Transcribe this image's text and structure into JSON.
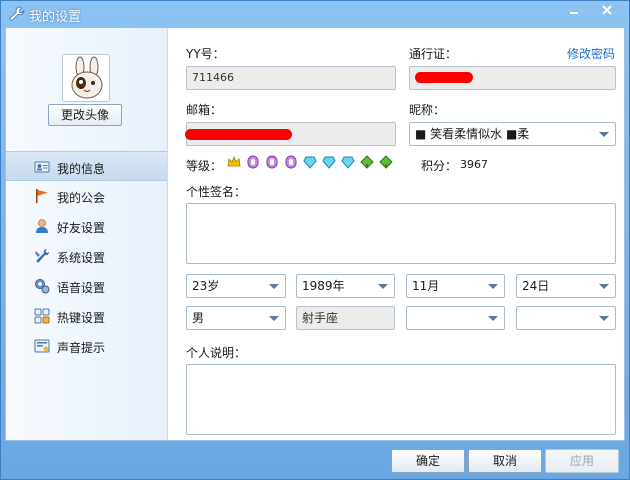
{
  "window": {
    "title": "我的设置",
    "minimize_icon": "minimize-icon",
    "close_icon": "close-icon"
  },
  "sidebar": {
    "change_avatar_label": "更改头像",
    "items": [
      {
        "label": "我的信息",
        "icon": "id-card-icon",
        "active": true
      },
      {
        "label": "我的公会",
        "icon": "flag-icon"
      },
      {
        "label": "好友设置",
        "icon": "user-icon"
      },
      {
        "label": "系统设置",
        "icon": "tools-icon"
      },
      {
        "label": "语音设置",
        "icon": "mic-gear-icon"
      },
      {
        "label": "热键设置",
        "icon": "keyboard-icon"
      },
      {
        "label": "声音提示",
        "icon": "sound-icon"
      }
    ]
  },
  "form": {
    "yy_label": "YY号：",
    "yy_value": "711466",
    "passport_label": "通行证：",
    "change_password_link": "修改密码",
    "email_label": "邮箱：",
    "nickname_label": "昵称：",
    "nickname_value": "■ 笑看柔情似水 ■柔",
    "level_label": "等级：",
    "points_label": "积分：",
    "points_value": "3967",
    "signature_label": "个性签名：",
    "age_value": "23岁",
    "year_value": "1989年",
    "month_value": "11月",
    "day_value": "24日",
    "gender_value": "男",
    "zodiac_value": "射手座",
    "bio_label": "个人说明："
  },
  "buttons": {
    "ok": "确定",
    "cancel": "取消",
    "apply": "应用"
  },
  "colors": {
    "accent": "#1a6fd0",
    "titlebar": "#7fb4e6",
    "redaction": "#ff0000"
  }
}
